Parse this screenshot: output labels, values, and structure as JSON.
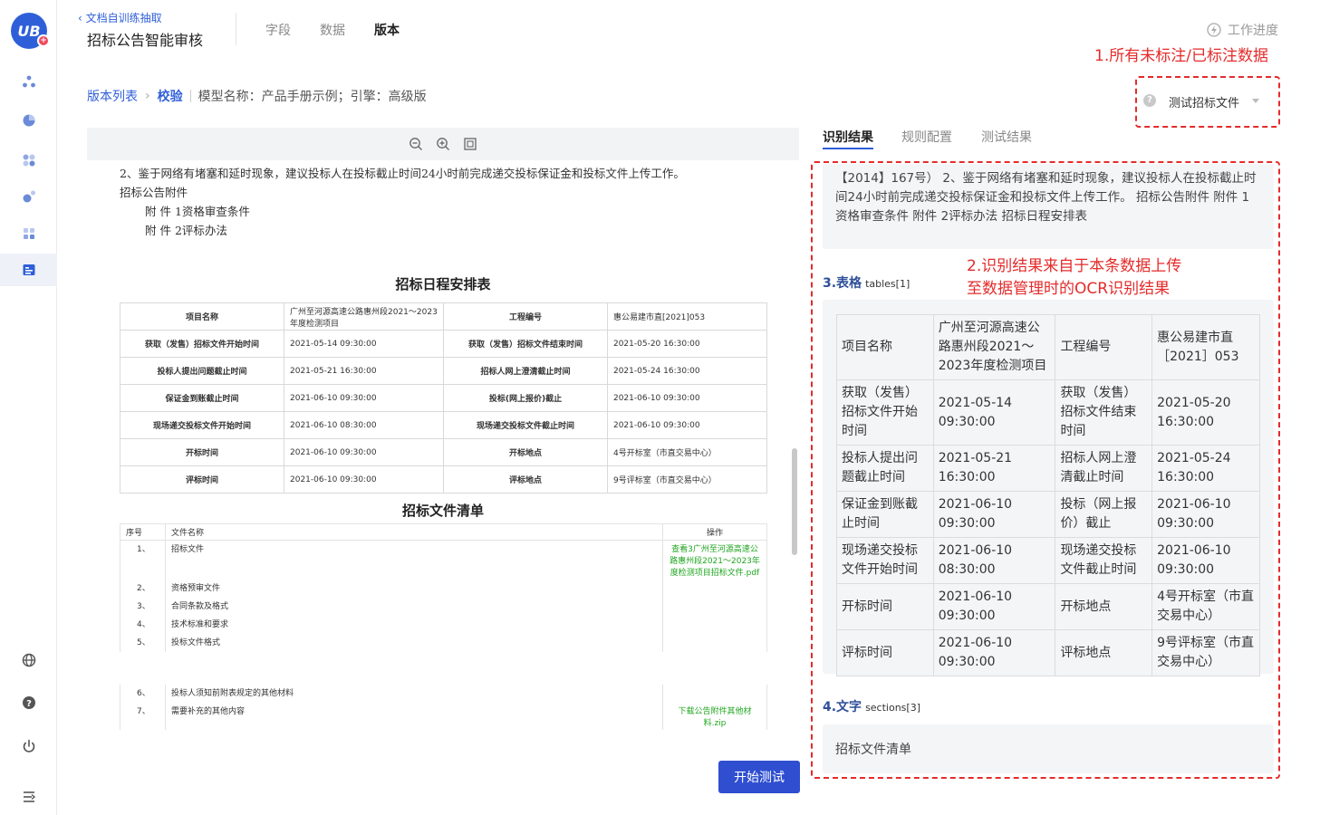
{
  "header": {
    "back_label": "文档自训练抽取",
    "app_title": "招标公告智能审核",
    "tabs": [
      "字段",
      "数据",
      "版本"
    ],
    "active_tab": "版本",
    "progress_label": "工作进度"
  },
  "breadcrumb": {
    "list_label": "版本列表",
    "current": "校验",
    "model_info": "模型名称：产品手册示例；引擎：高级版"
  },
  "annotations": {
    "note1": "1.所有未标注/已标注数据",
    "note2_line1": "2.识别结果来自于本条数据上传",
    "note2_line2": "至数据管理时的OCR识别结果",
    "color": "#e52b2b"
  },
  "doc_select": {
    "value": "测试招标文件",
    "help": "?"
  },
  "preview": {
    "lines": [
      "2、鉴于网络有堵塞和延时现象，建议投标人在投标截止时间24小时前完成递交投标保证金和投标文件上传工作。",
      "招标公告附件",
      "附 件 1资格审查条件",
      "附 件 2评标办法"
    ],
    "schedule_title": "招标日程安排表",
    "schedule_rows": [
      [
        "项目名称",
        "广州至河源高速公路惠州段2021～2023年度检测项目",
        "工程编号",
        "惠公易建市直[2021]053"
      ],
      [
        "获取（发售）招标文件开始时间",
        "2021-05-14 09:30:00",
        "获取（发售）招标文件结束时间",
        "2021-05-20 16:30:00"
      ],
      [
        "投标人提出问题截止时间",
        "2021-05-21 16:30:00",
        "招标人网上澄清截止时间",
        "2021-05-24 16:30:00"
      ],
      [
        "保证金到账截止时间",
        "2021-06-10 09:30:00",
        "投标(网上报价)截止",
        "2021-06-10 09:30:00"
      ],
      [
        "现场递交投标文件开始时间",
        "2021-06-10 08:30:00",
        "现场递交投标文件截止时间",
        "2021-06-10 09:30:00"
      ],
      [
        "开标时间",
        "2021-06-10 09:30:00",
        "开标地点",
        "4号开标室（市直交易中心）"
      ],
      [
        "评标时间",
        "2021-06-10 09:30:00",
        "评标地点",
        "9号评标室（市直交易中心）"
      ]
    ],
    "list_title": "招标文件清单",
    "list_header": [
      "序号",
      "文件名称",
      "操作"
    ],
    "list_rows": [
      [
        "1、",
        "招标文件",
        "查看3广州至河源高速公路惠州段2021～2023年度检测项目招标文件.pdf"
      ],
      [
        "2、",
        "资格预审文件",
        ""
      ],
      [
        "3、",
        "合同条款及格式",
        ""
      ],
      [
        "4、",
        "技术标准和要求",
        ""
      ],
      [
        "5、",
        "投标文件格式",
        ""
      ]
    ],
    "list_rows_2": [
      [
        "6、",
        "投标人须知前附表规定的其他材料",
        ""
      ],
      [
        "7、",
        "需要补充的其他内容",
        "下载公告附件其他材料.zip"
      ]
    ]
  },
  "start_button": "开始测试",
  "right_tabs": [
    "识别结果",
    "规则配置",
    "测试结果"
  ],
  "result": {
    "text_partial": "【2014】167号） 2、鉴于网络有堵塞和延时现象，建议投标人在投标截止时间24小时前完成递交投标保证金和投标文件上传工作。 招标公告附件 附件 1资格审查条件 附件 2评标办法 招标日程安排表",
    "tables_title": "3.表格",
    "tables_sub": "tables[1]",
    "table_rows": [
      [
        "项目名称",
        "广州至河源高速公路惠州段2021～2023年度检测项目",
        "工程编号",
        "惠公易建市直［2021］053"
      ],
      [
        "获取（发售）招标文件开始时间",
        "2021-05-14 09:30:00",
        "获取（发售）招标文件结束时间",
        "2021-05-20 16:30:00"
      ],
      [
        "投标人提出问题截止时间",
        "2021-05-21 16:30:00",
        "招标人网上澄清截止时间",
        "2021-05-24 16:30:00"
      ],
      [
        "保证金到账截止时间",
        "2021-06-10 09:30:00",
        "投标（网上报价）截止",
        "2021-06-10 09:30:00"
      ],
      [
        "现场递交投标文件开始时间",
        "2021-06-10 08:30:00",
        "现场递交投标文件截止时间",
        "2021-06-10 09:30:00"
      ],
      [
        "开标时间",
        "2021-06-10 09:30:00",
        "开标地点",
        "4号开标室（市直交易中心）"
      ],
      [
        "评标时间",
        "2021-06-10 09:30:00",
        "评标地点",
        "9号评标室（市直交易中心）"
      ]
    ],
    "sections_title": "4.文字",
    "sections_sub": "sections[3]",
    "section_text": "招标文件清单"
  }
}
